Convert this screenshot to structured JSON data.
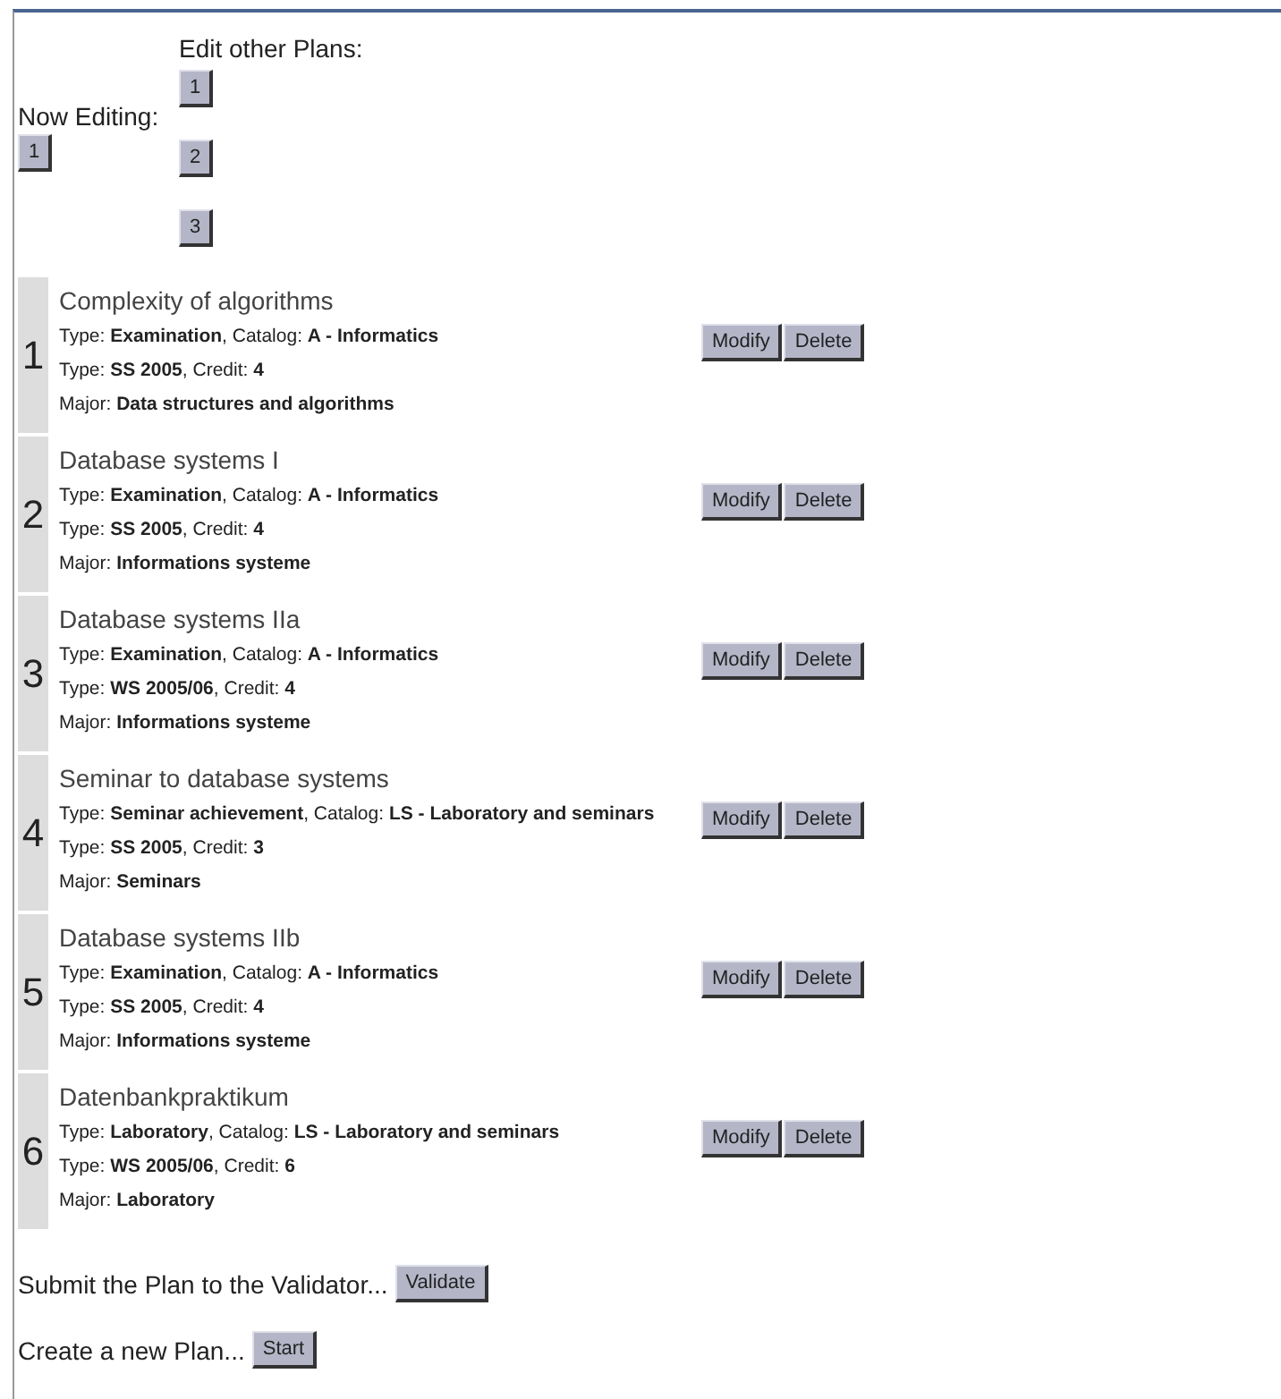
{
  "now_editing": {
    "label": "Now Editing:",
    "plan_button": "1"
  },
  "other_plans": {
    "label": "Edit other Plans:",
    "buttons": [
      "1",
      "2",
      "3"
    ]
  },
  "plans": [
    {
      "number": "1",
      "title": "Complexity of algorithms",
      "lines": [
        "Type: **Examination**, Catalog: **A - Informatics**",
        "Type: **SS 2005**, Credit: **4**",
        "Major: **Data structures and algorithms**"
      ],
      "modify": "Modify",
      "delete": "Delete"
    },
    {
      "number": "2",
      "title": "Database systems I",
      "lines": [
        "Type: **Examination**, Catalog: **A - Informatics**",
        "Type: **SS 2005**, Credit: **4**",
        "Major: **Informations systeme**"
      ],
      "modify": "Modify",
      "delete": "Delete"
    },
    {
      "number": "3",
      "title": "Database systems IIa",
      "lines": [
        "Type: **Examination**, Catalog: **A - Informatics**",
        "Type: **WS 2005/06**, Credit: **4**",
        "Major: **Informations systeme**"
      ],
      "modify": "Modify",
      "delete": "Delete"
    },
    {
      "number": "4",
      "title": "Seminar to database systems",
      "lines": [
        "Type: **Seminar achievement**, Catalog: **LS - Laboratory and seminars**",
        "Type: **SS 2005**, Credit: **3**",
        "Major: **Seminars**"
      ],
      "modify": "Modify",
      "delete": "Delete"
    },
    {
      "number": "5",
      "title": "Database systems IIb",
      "lines": [
        "Type: **Examination**, Catalog: **A - Informatics**",
        "Type: **SS 2005**, Credit: **4**",
        "Major: **Informations systeme**"
      ],
      "modify": "Modify",
      "delete": "Delete"
    },
    {
      "number": "6",
      "title": "Datenbankpraktikum",
      "lines": [
        "Type: **Laboratory**, Catalog: **LS - Laboratory and seminars**",
        "Type: **WS 2005/06**, Credit: **6**",
        "Major: **Laboratory**"
      ],
      "modify": "Modify",
      "delete": "Delete"
    }
  ],
  "actions": [
    {
      "text": "Submit the Plan to the Validator...",
      "button": "Validate"
    },
    {
      "text": "Create a new Plan...",
      "button": "Start"
    }
  ]
}
